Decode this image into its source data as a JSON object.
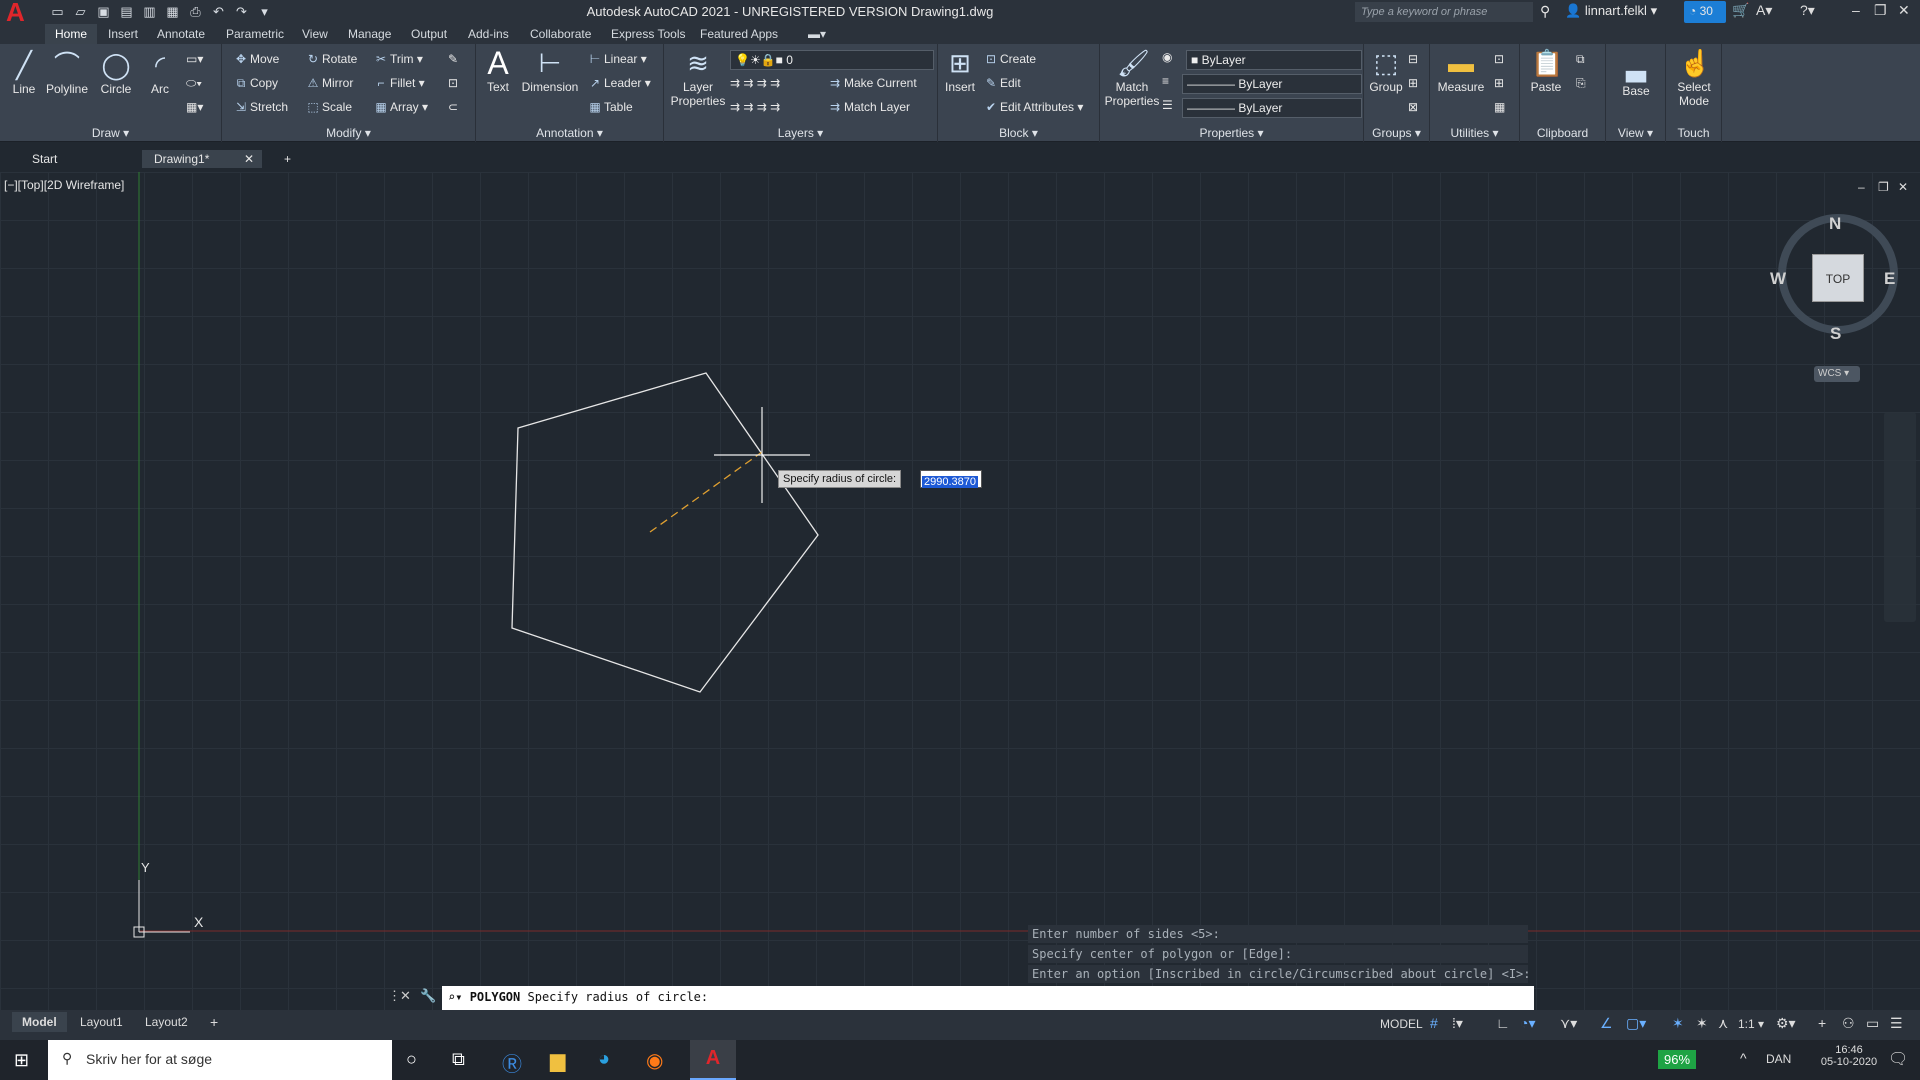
{
  "app": {
    "title": "Autodesk AutoCAD 2021 - UNREGISTERED VERSION    Drawing1.dwg",
    "search_placeholder": "Type a keyword or phrase",
    "user": "linnart.felkl",
    "badge": "30"
  },
  "menu_tabs": [
    "Home",
    "Insert",
    "Annotate",
    "Parametric",
    "View",
    "Manage",
    "Output",
    "Add-ins",
    "Collaborate",
    "Express Tools",
    "Featured Apps"
  ],
  "ribbon": {
    "draw": {
      "label": "Draw",
      "line": "Line",
      "polyline": "Polyline",
      "circle": "Circle",
      "arc": "Arc"
    },
    "modify": {
      "label": "Modify",
      "move": "Move",
      "rotate": "Rotate",
      "trim": "Trim",
      "copy": "Copy",
      "mirror": "Mirror",
      "fillet": "Fillet",
      "stretch": "Stretch",
      "scale": "Scale",
      "array": "Array"
    },
    "annotation": {
      "label": "Annotation",
      "text": "Text",
      "dimension": "Dimension",
      "linear": "Linear",
      "leader": "Leader",
      "table": "Table"
    },
    "layers": {
      "label": "Layers",
      "properties": "Layer Properties",
      "layer": "0",
      "make_current": "Make Current",
      "match_layer": "Match Layer"
    },
    "block": {
      "label": "Block",
      "insert": "Insert",
      "create": "Create",
      "edit": "Edit",
      "edit_attributes": "Edit Attributes"
    },
    "properties": {
      "label": "Properties",
      "match": "Match Properties",
      "color": "ByLayer",
      "linetype": "ByLayer",
      "lineweight": "ByLayer"
    },
    "groups": {
      "label": "Groups",
      "group": "Group"
    },
    "utilities": {
      "label": "Utilities",
      "measure": "Measure"
    },
    "clipboard": {
      "label": "Clipboard",
      "paste": "Paste"
    },
    "view": {
      "label": "View",
      "base": "Base"
    },
    "touch": {
      "label": "Touch",
      "select_mode": "Select Mode"
    }
  },
  "doc_tabs": {
    "start": "Start",
    "drawing": "Drawing1*"
  },
  "viewport": {
    "label": "[−][Top][2D Wireframe]"
  },
  "viewcube": {
    "n": "N",
    "s": "S",
    "e": "E",
    "w": "W",
    "face": "TOP",
    "wcs": "WCS"
  },
  "ucs": {
    "x": "X",
    "y": "Y"
  },
  "prompt": {
    "tooltip": "Specify radius of circle:",
    "value": "2990.3870"
  },
  "cmd_history": [
    "Enter number of sides <5>:",
    "Specify center of polygon or [Edge]:",
    "Enter an option [Inscribed in circle/Circumscribed about circle] <I>: C"
  ],
  "cmd_line": {
    "command": "POLYGON",
    "text": "Specify radius of circle:"
  },
  "layout_tabs": [
    "Model",
    "Layout1",
    "Layout2"
  ],
  "status": {
    "model": "MODEL",
    "scale": "1:1"
  },
  "taskbar": {
    "search": "Skriv her for at søge",
    "battery": "96%",
    "lang": "DAN",
    "time": "16:46",
    "date": "05-10-2020"
  }
}
